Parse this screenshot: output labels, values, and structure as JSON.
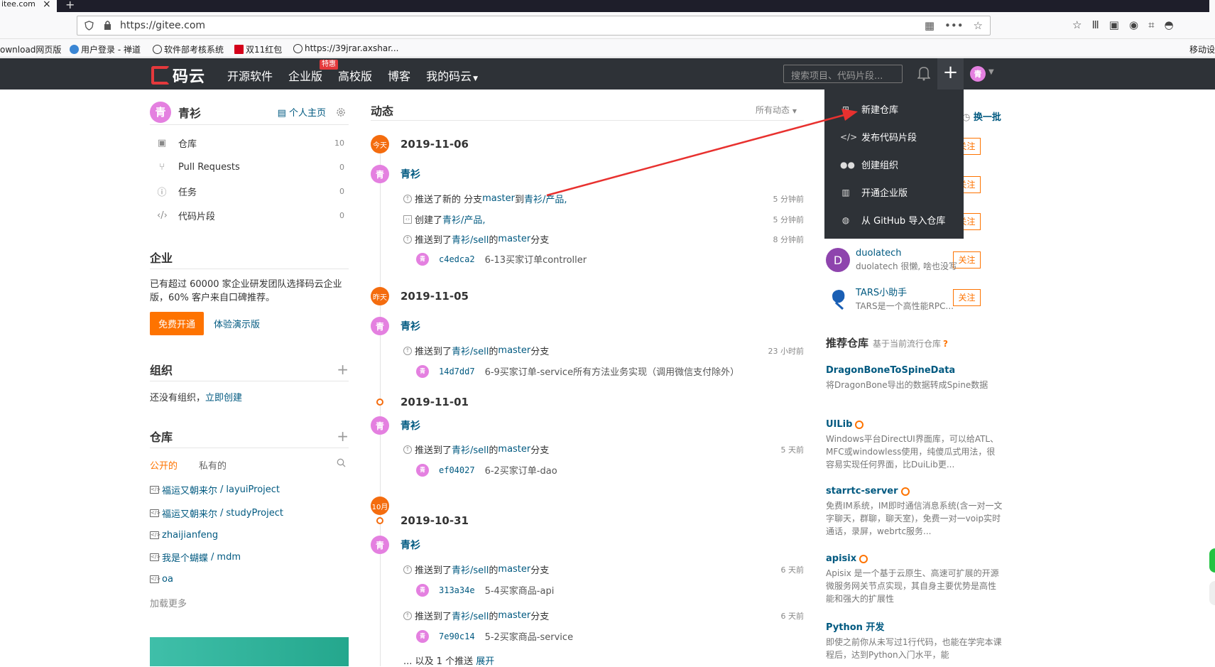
{
  "browser": {
    "tab_title": "itee.com",
    "url": "https://gitee.com",
    "bookmarks": [
      "ownload网页版",
      "用户登录 - 禅道",
      "软件部考核系统",
      "双11红包",
      "https://39jrar.axshar..."
    ],
    "mobile_bookmark": "移动设"
  },
  "header": {
    "logo": "码云",
    "nav": [
      "开源软件",
      "企业版",
      "高校版",
      "博客",
      "我的码云"
    ],
    "hot_badge": "特惠",
    "search_placeholder": "搜索项目、代码片段...",
    "plus": "+",
    "avatar": "青"
  },
  "dropdown": {
    "items": [
      {
        "icon": "new-repo-icon",
        "label": "新建仓库"
      },
      {
        "icon": "code-snippet-icon",
        "label": "发布代码片段"
      },
      {
        "icon": "group-icon",
        "label": "创建组织"
      },
      {
        "icon": "building-icon",
        "label": "开通企业版"
      },
      {
        "icon": "github-icon",
        "label": "从 GitHub 导入仓库"
      }
    ]
  },
  "sidebar": {
    "user": {
      "avatar": "青",
      "name": "青衫",
      "homepage": "个人主页"
    },
    "stats": [
      {
        "label": "仓库",
        "count": "10"
      },
      {
        "label": "Pull Requests",
        "count": "0"
      },
      {
        "label": "任务",
        "count": "0"
      },
      {
        "label": "代码片段",
        "count": "0"
      }
    ],
    "enterprise": {
      "title": "企业",
      "text": "已有超过 60000 家企业研发团队选择码云企业版，60% 客户来自口碑推荐。",
      "btn": "免费开通",
      "demo": "体验演示版"
    },
    "org": {
      "title": "组织",
      "text": "还没有组织，",
      "create": "立即创建"
    },
    "repos": {
      "title": "仓库",
      "tab_public": "公开的",
      "tab_private": "私有的",
      "items": [
        {
          "owner": "福运又朝来尔",
          "name": "layuiProject"
        },
        {
          "owner": "福运又朝来尔",
          "name": "studyProject"
        },
        {
          "owner": "",
          "name": "zhaijianfeng"
        },
        {
          "owner": "我是个蝴蝶",
          "name": "mdm"
        },
        {
          "owner": "",
          "name": "oa"
        }
      ],
      "load_more": "加载更多"
    }
  },
  "feed": {
    "title": "动态",
    "filter": "所有动态",
    "groups": [
      {
        "badge": "今天",
        "date": "2019-11-06"
      },
      {
        "badge": "昨天",
        "date": "2019-11-05"
      },
      {
        "badge": "",
        "date": "2019-11-01"
      },
      {
        "badge": "10月",
        "date": "2019-10-31"
      }
    ],
    "user": "青衫",
    "avatar": "青",
    "acts": [
      {
        "pre": "推送了新的 分支 ",
        "ref": "master",
        "mid": " 到 ",
        "repo": "青衫/产品,",
        "post": "",
        "time": "5 分钟前"
      },
      {
        "pre": "创建了 ",
        "ref": "",
        "mid": "",
        "repo": "青衫/产品,",
        "post": "",
        "time": "5 分钟前"
      },
      {
        "pre": "推送到了 ",
        "ref": "青衫/sell",
        "mid": " 的 ",
        "repo": "master",
        "post": " 分支",
        "time": "8 分钟前"
      },
      {
        "pre": "推送到了 ",
        "ref": "青衫/sell",
        "mid": " 的 ",
        "repo": "master",
        "post": " 分支",
        "time": "23 小时前"
      },
      {
        "pre": "推送到了 ",
        "ref": "青衫/sell",
        "mid": " 的 ",
        "repo": "master",
        "post": " 分支",
        "time": "5 天前"
      },
      {
        "pre": "推送到了 ",
        "ref": "青衫/sell",
        "mid": " 的 ",
        "repo": "master",
        "post": " 分支",
        "time": "6 天前"
      },
      {
        "pre": "推送到了 ",
        "ref": "青衫/sell",
        "mid": " 的 ",
        "repo": "master",
        "post": " 分支",
        "time": "6 天前"
      }
    ],
    "commits": [
      {
        "sha": "c4edca2",
        "msg": "6-13买家订单controller"
      },
      {
        "sha": "14d7dd7",
        "msg": "6-9买家订单-service所有方法业务实现（调用微信支付除外）"
      },
      {
        "sha": "ef04027",
        "msg": "6-2买家订单-dao"
      },
      {
        "sha": "313a34e",
        "msg": "5-4买家商品-api"
      },
      {
        "sha": "7e90c14",
        "msg": "5-2买家商品-service"
      }
    ],
    "more": "... 以及 1 个推送 ",
    "expand": "展开"
  },
  "right": {
    "swap": "换一批",
    "follow": "关注",
    "users": [
      {
        "avatar": "D",
        "name": "duolatech",
        "desc": "duolatech 很懒, 啥也没写",
        "color": "#8e44ad"
      },
      {
        "avatar": "",
        "name": "TARS小助手",
        "desc": "TARS是一个高性能RPC...",
        "color": "#1a5fb4"
      }
    ],
    "rec_title": "推荐仓库",
    "rec_sub": "基于当前流行仓库",
    "repos": [
      {
        "name": "DragonBoneToSpineData",
        "desc": "将DragonBone导出的数据转成Spine数据",
        "gvp": false
      },
      {
        "name": "UILib",
        "desc": "Windows平台DirectUI界面库，可以给ATL、MFC或windowless使用，纯傻瓜式用法，很容易实现任何界面，比DuiLib更...",
        "gvp": true
      },
      {
        "name": "starrtc-server",
        "desc": "免费IM系统，IM即时通信消息系统(含一对一文字聊天，群聊，聊天室)，免费一对一voip实时通话，录屏，webrtc服务...",
        "gvp": true
      },
      {
        "name": "apisix",
        "desc": "Apisix 是一个基于云原生、高速可扩展的开源微服务网关节点实现，其自身主要优势是高性能和强大的扩展性",
        "gvp": true
      },
      {
        "name": "Python 开发",
        "desc": "即使之前你从未写过1行代码，也能在学完本课程后，达到Python入门水平，能",
        "gvp": false
      }
    ]
  },
  "colors": {
    "brand": "#e4393c",
    "orange": "#fe7300",
    "link": "#005980",
    "header_bg": "#2e3237"
  }
}
